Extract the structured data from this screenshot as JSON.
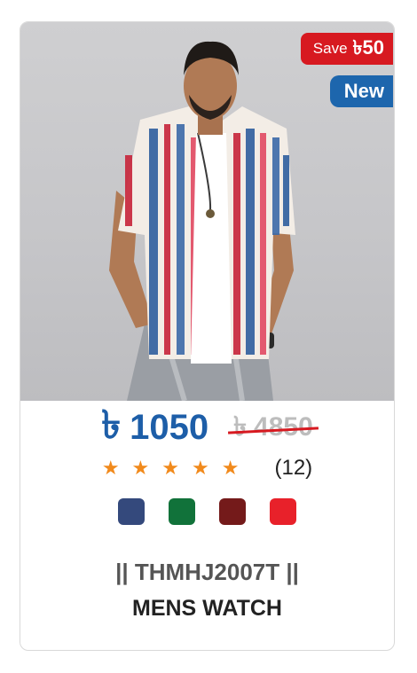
{
  "badges": {
    "save_label": "Save",
    "save_currency": "৳",
    "save_amount": "50",
    "new_label": "New"
  },
  "price": {
    "currency": "৳",
    "current": "1050",
    "old": "4850"
  },
  "rating": {
    "stars": 5,
    "star_glyph": "★",
    "count": "(12)"
  },
  "colors": {
    "options": [
      "#34497c",
      "#11723a",
      "#741a1a",
      "#e8212a"
    ],
    "price_blue": "#1d5ea8",
    "badge_red": "#d71920",
    "badge_blue": "#1d66ad",
    "star_orange": "#f18a1c"
  },
  "product": {
    "sku": "|| THMHJ2007T ||",
    "name": "MENS WATCH",
    "image_alt": "man-wearing-printed-shirt-image"
  }
}
